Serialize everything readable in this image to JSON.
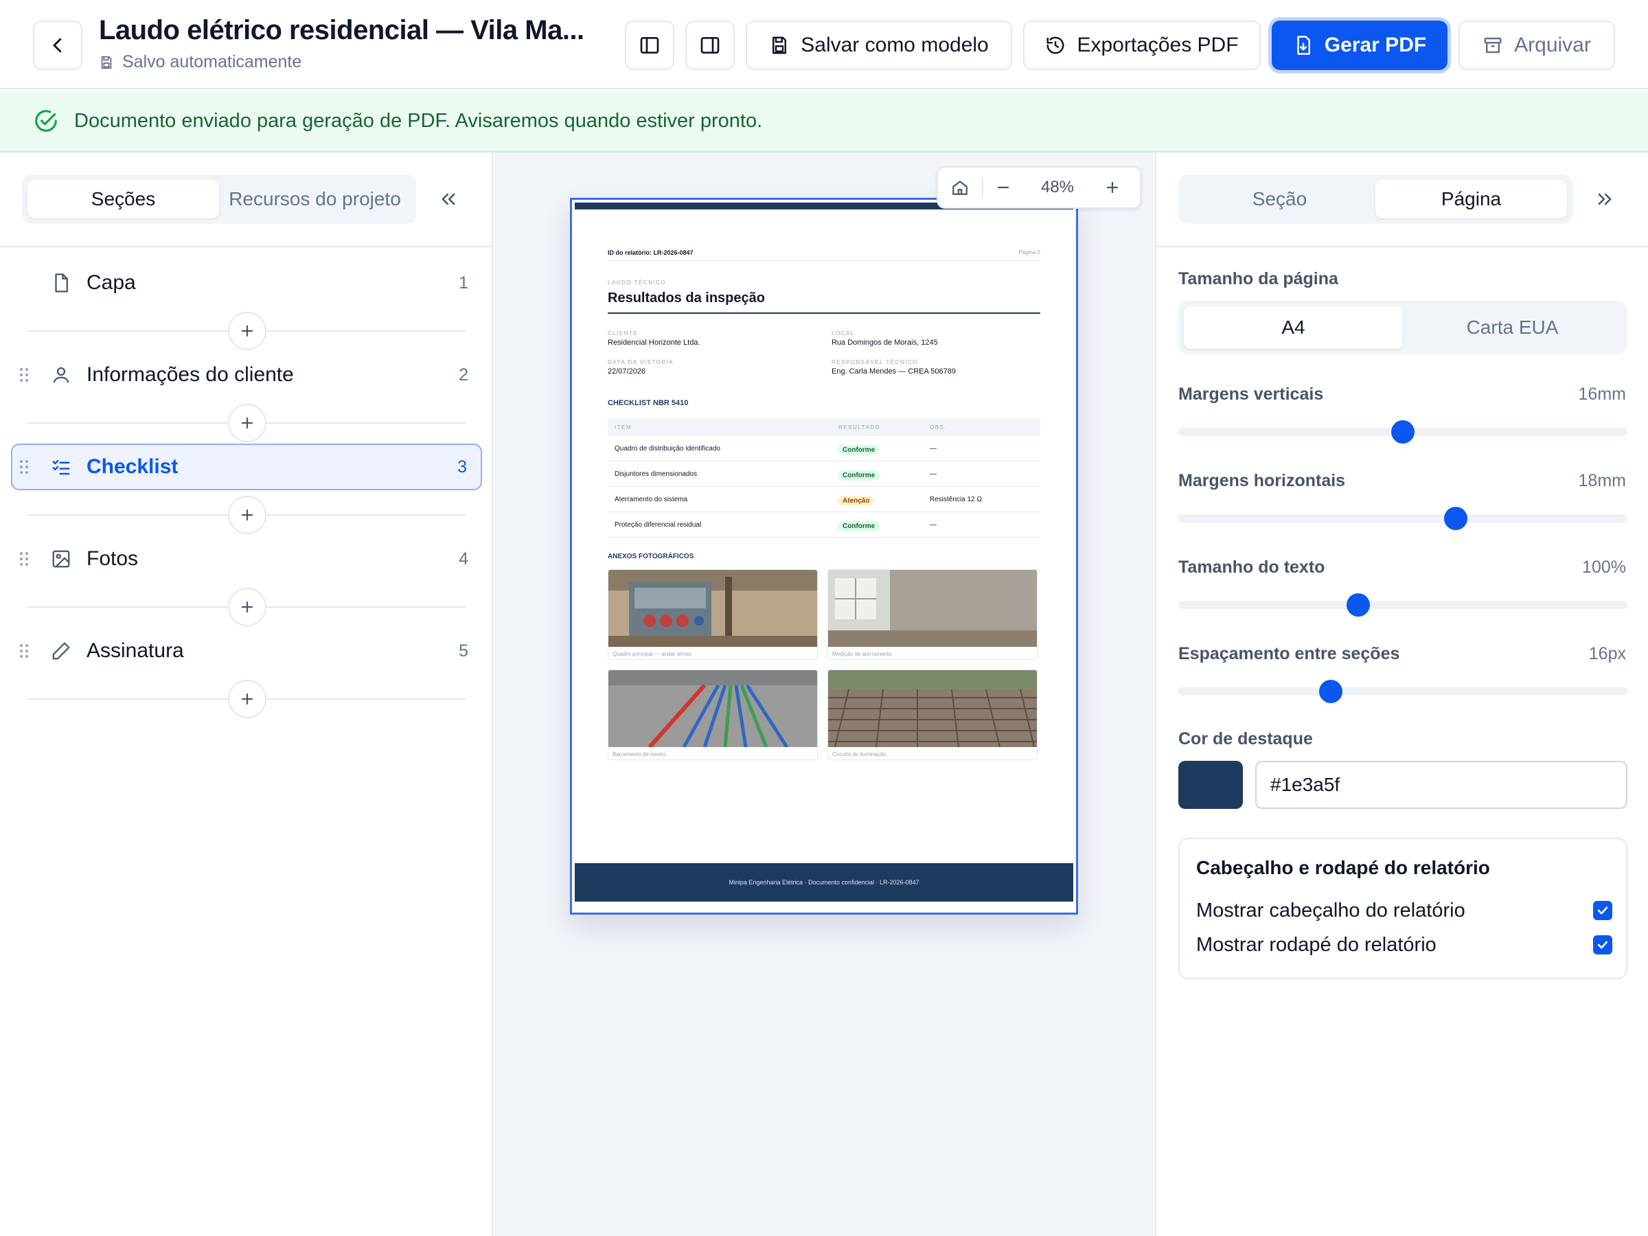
{
  "header": {
    "title": "Laudo elétrico residencial — Vila Ma...",
    "saved_status": "Salvo automaticamente",
    "buttons": {
      "save_template": "Salvar como modelo",
      "exports": "Exportações PDF",
      "generate": "Gerar PDF",
      "archive": "Arquivar"
    }
  },
  "banner": {
    "message": "Documento enviado para geração de PDF. Avisaremos quando estiver pronto."
  },
  "left_panel": {
    "tabs": [
      "Seções",
      "Recursos do projeto"
    ],
    "active_tab": "Seções",
    "sections": [
      {
        "label": "Capa",
        "number": "1",
        "icon": "file-icon"
      },
      {
        "label": "Informações do cliente",
        "number": "2",
        "icon": "user-icon"
      },
      {
        "label": "Checklist",
        "number": "3",
        "icon": "checklist-icon",
        "active": true
      },
      {
        "label": "Fotos",
        "number": "4",
        "icon": "image-icon"
      },
      {
        "label": "Assinatura",
        "number": "5",
        "icon": "pen-icon"
      }
    ]
  },
  "canvas": {
    "zoom": "48%"
  },
  "preview": {
    "report_id": "ID do relatório: LR-2026-0847",
    "page_label": "Página 2",
    "kicker": "LAUDO TÉCNICO",
    "heading": "Resultados da inspeção",
    "fields": {
      "client_label": "CLIENTE",
      "client": "Residencial Horizonte Ltda.",
      "location_label": "LOCAL",
      "location": "Rua Domingos de Morais, 1245",
      "date_label": "DATA DA VISTORIA",
      "date": "22/07/2026",
      "engineer_label": "RESPONSÁVEL TÉCNICO",
      "engineer": "Eng. Carla Mendes — CREA 506789"
    },
    "checklist_title": "CHECKLIST NBR 5410",
    "checklist_headers": [
      "ITEM",
      "RESULTADO",
      "OBS."
    ],
    "checklist_rows": [
      {
        "item": "Quadro de distribuição identificado",
        "result": "Conforme",
        "status": "ok",
        "obs": "—"
      },
      {
        "item": "Disjuntores dimensionados",
        "result": "Conforme",
        "status": "ok",
        "obs": "—"
      },
      {
        "item": "Aterramento do sistema",
        "result": "Atenção",
        "status": "warn",
        "obs": "Resistência 12 Ω"
      },
      {
        "item": "Proteção diferencial residual",
        "result": "Conforme",
        "status": "ok",
        "obs": "—"
      }
    ],
    "photos_title": "ANEXOS FOTOGRÁFICOS",
    "photos": [
      "Quadro principal — andar térreo",
      "Medição de aterramento",
      "Barramento de neutro",
      "Circuito de iluminação"
    ],
    "footer": "Minipa Engenharia Elétrica · Documento confidencial · LR-2026-0847"
  },
  "right_panel": {
    "tabs": [
      "Seção",
      "Página"
    ],
    "active_tab": "Página",
    "page_size": {
      "label": "Tamanho da página",
      "options": [
        "A4",
        "Carta EUA"
      ],
      "selected": "A4"
    },
    "sliders": [
      {
        "label": "Margens verticais",
        "value": "16mm",
        "level": 0.5
      },
      {
        "label": "Margens horizontais",
        "value": "18mm",
        "level": 0.617
      },
      {
        "label": "Tamanho do texto",
        "value": "100%",
        "level": 0.4
      },
      {
        "label": "Espaçamento entre seções",
        "value": "16px",
        "level": 0.34
      }
    ],
    "accent": {
      "label": "Cor de destaque",
      "value": "#1e3a5f"
    },
    "header_footer": {
      "title": "Cabeçalho e rodapé do relatório",
      "show_header": "Mostrar cabeçalho do relatório",
      "show_footer": "Mostrar rodapé do relatório",
      "show_header_checked": true,
      "show_footer_checked": true
    }
  },
  "colors": {
    "primary": "#0b57f0",
    "accent": "#1e3a5f",
    "success_bg": "#ecfbf2",
    "success_text": "#166534"
  }
}
